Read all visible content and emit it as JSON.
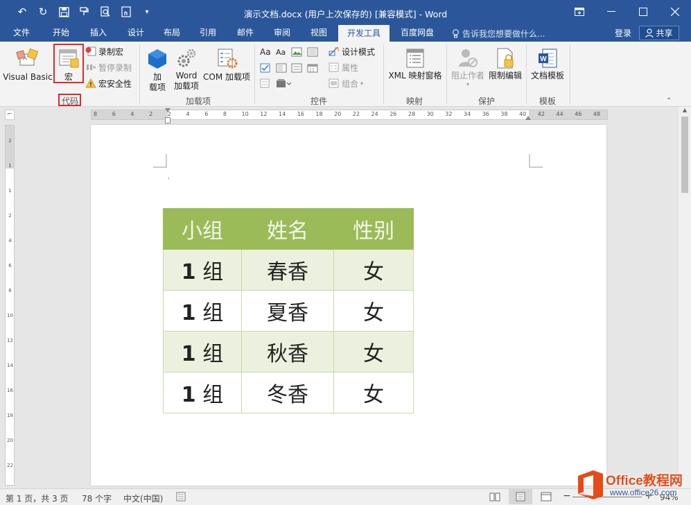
{
  "title": "演示文档.docx (用户上次保存的) [兼容模式] - Word",
  "tabs": [
    "文件",
    "开始",
    "插入",
    "设计",
    "布局",
    "引用",
    "邮件",
    "审阅",
    "视图",
    "开发工具",
    "百度网盘"
  ],
  "active_tab": "开发工具",
  "tell_me": "告诉我您想要做什么...",
  "login": "登录",
  "share": "共享",
  "ribbon": {
    "code": {
      "label": "代码",
      "visual_basic": "Visual Basic",
      "macros": "宏",
      "record_macro": "录制宏",
      "pause_recording": "暂停录制",
      "macro_security": "宏安全性"
    },
    "addins": {
      "label": "加载项",
      "addins_l1": "加",
      "addins_l2": "载项",
      "word_l1": "Word",
      "word_l2": "加载项",
      "com": "COM 加载项"
    },
    "controls": {
      "label": "控件",
      "design_mode": "设计模式",
      "properties": "属性",
      "group": "组合"
    },
    "mapping": {
      "label": "映射",
      "xml_pane": "XML 映射窗格"
    },
    "protect": {
      "label": "保护",
      "block_authors": "阻止作者",
      "restrict_editing": "限制编辑"
    },
    "templates": {
      "label": "模板",
      "doc_template": "文档模板"
    }
  },
  "ruler_numbers": [
    "8",
    "6",
    "4",
    "2",
    "2",
    "4",
    "6",
    "8",
    "10",
    "12",
    "14",
    "16",
    "18",
    "20",
    "22",
    "24",
    "26",
    "28",
    "30",
    "32",
    "34",
    "36",
    "38",
    "40",
    "42",
    "44",
    "46",
    "48"
  ],
  "vruler_numbers": [
    "2",
    "1",
    "1",
    "2",
    "4",
    "6",
    "8",
    "10",
    "12",
    "14",
    "16",
    "18",
    "20",
    "22"
  ],
  "table": {
    "headers": [
      "小组",
      "姓名",
      "性别"
    ],
    "rows": [
      {
        "num": "1",
        "grp": "组",
        "name": "春香",
        "gender": "女"
      },
      {
        "num": "1",
        "grp": "组",
        "name": "夏香",
        "gender": "女"
      },
      {
        "num": "1",
        "grp": "组",
        "name": "秋香",
        "gender": "女"
      },
      {
        "num": "1",
        "grp": "组",
        "name": "冬香",
        "gender": "女"
      }
    ]
  },
  "status": {
    "page": "第 1 页，共 3 页",
    "words": "78 个字",
    "language": "中文(中国)",
    "zoom": "94%"
  },
  "watermark": {
    "brand": "Office教程网",
    "url": "www.office26.com"
  },
  "colors": {
    "titlebar": "#2b579a",
    "table_header": "#9bbb59",
    "table_band": "#ebf1de",
    "highlight": "#e0282e"
  }
}
